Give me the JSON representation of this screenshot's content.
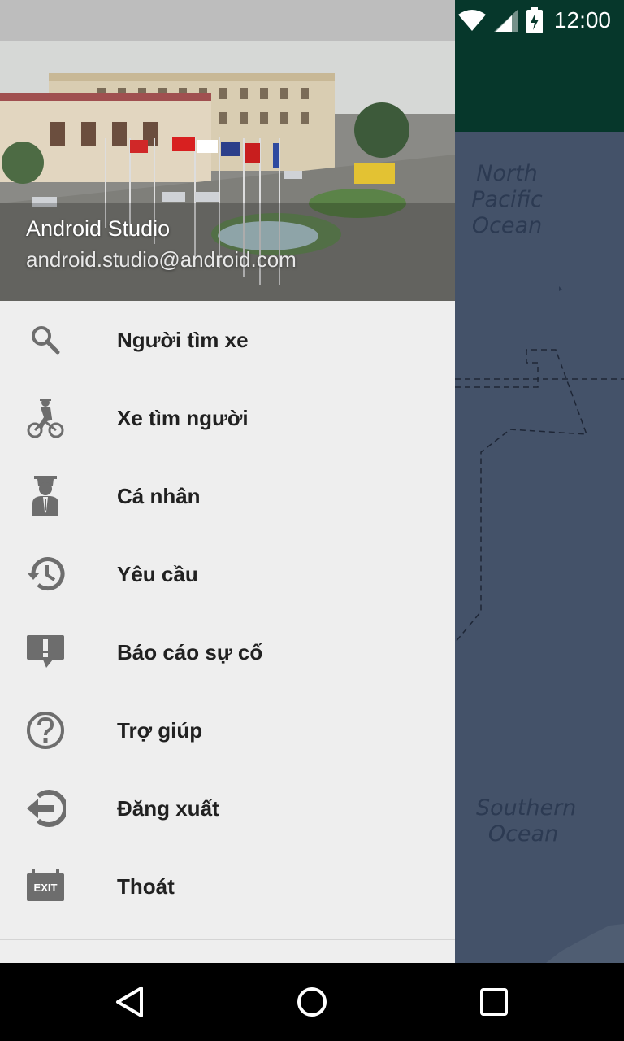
{
  "status_bar": {
    "time": "12:00"
  },
  "drawer": {
    "header": {
      "name": "Android Studio",
      "email": "android.studio@android.com"
    },
    "items": [
      {
        "label": "Người tìm xe",
        "icon": "search-icon"
      },
      {
        "label": "Xe tìm người",
        "icon": "bicycle-rider-icon"
      },
      {
        "label": "Cá nhân",
        "icon": "graduate-person-icon"
      },
      {
        "label": "Yêu cầu",
        "icon": "history-icon"
      },
      {
        "label": "Báo cáo sự cố",
        "icon": "report-problem-icon"
      },
      {
        "label": "Trợ giúp",
        "icon": "help-icon"
      },
      {
        "label": "Đăng xuất",
        "icon": "logout-icon"
      },
      {
        "label": "Thoát",
        "icon": "exit-icon",
        "badge": "EXIT"
      }
    ]
  },
  "map": {
    "label_north": "North Pacific Ocean",
    "label_south": "Southern Ocean"
  },
  "colors": {
    "drawer_bg": "#eeeeee",
    "map_water": "#445269",
    "toolbar": "#06372b",
    "icon_gray": "#6d6d6d"
  }
}
